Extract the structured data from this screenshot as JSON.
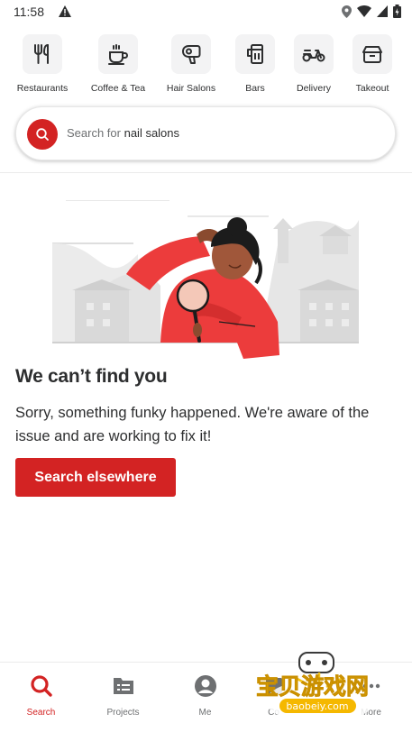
{
  "status_bar": {
    "time": "11:58"
  },
  "categories": [
    {
      "label": "Restaurants",
      "icon": "fork-knife-icon"
    },
    {
      "label": "Coffee & Tea",
      "icon": "coffee-cup-icon"
    },
    {
      "label": "Hair Salons",
      "icon": "hair-dryer-icon"
    },
    {
      "label": "Bars",
      "icon": "beer-glass-icon"
    },
    {
      "label": "Delivery",
      "icon": "scooter-icon"
    },
    {
      "label": "Takeout",
      "icon": "takeout-box-icon"
    }
  ],
  "search": {
    "prefix": "Search for ",
    "emphasis": "nail salons"
  },
  "error": {
    "title": "We can’t find you",
    "message": "Sorry, something funky happened. We're aware of the issue and are working to fix it!",
    "button": "Search elsewhere"
  },
  "bottom_nav": [
    {
      "label": "Search",
      "icon": "search-icon",
      "active": true
    },
    {
      "label": "Projects",
      "icon": "projects-icon",
      "active": false
    },
    {
      "label": "Me",
      "icon": "profile-icon",
      "active": false
    },
    {
      "label": "Co",
      "icon": "collections-icon",
      "active": false
    },
    {
      "label": "More",
      "icon": "more-icon",
      "active": false
    }
  ],
  "watermark": {
    "text": "宝贝游戏网",
    "url_text": "baobeiy.com"
  },
  "colors": {
    "brand_red": "#d32323",
    "text_dark": "#2d2e2f",
    "text_gray": "#6e7072",
    "icon_bg": "#f3f3f4"
  }
}
